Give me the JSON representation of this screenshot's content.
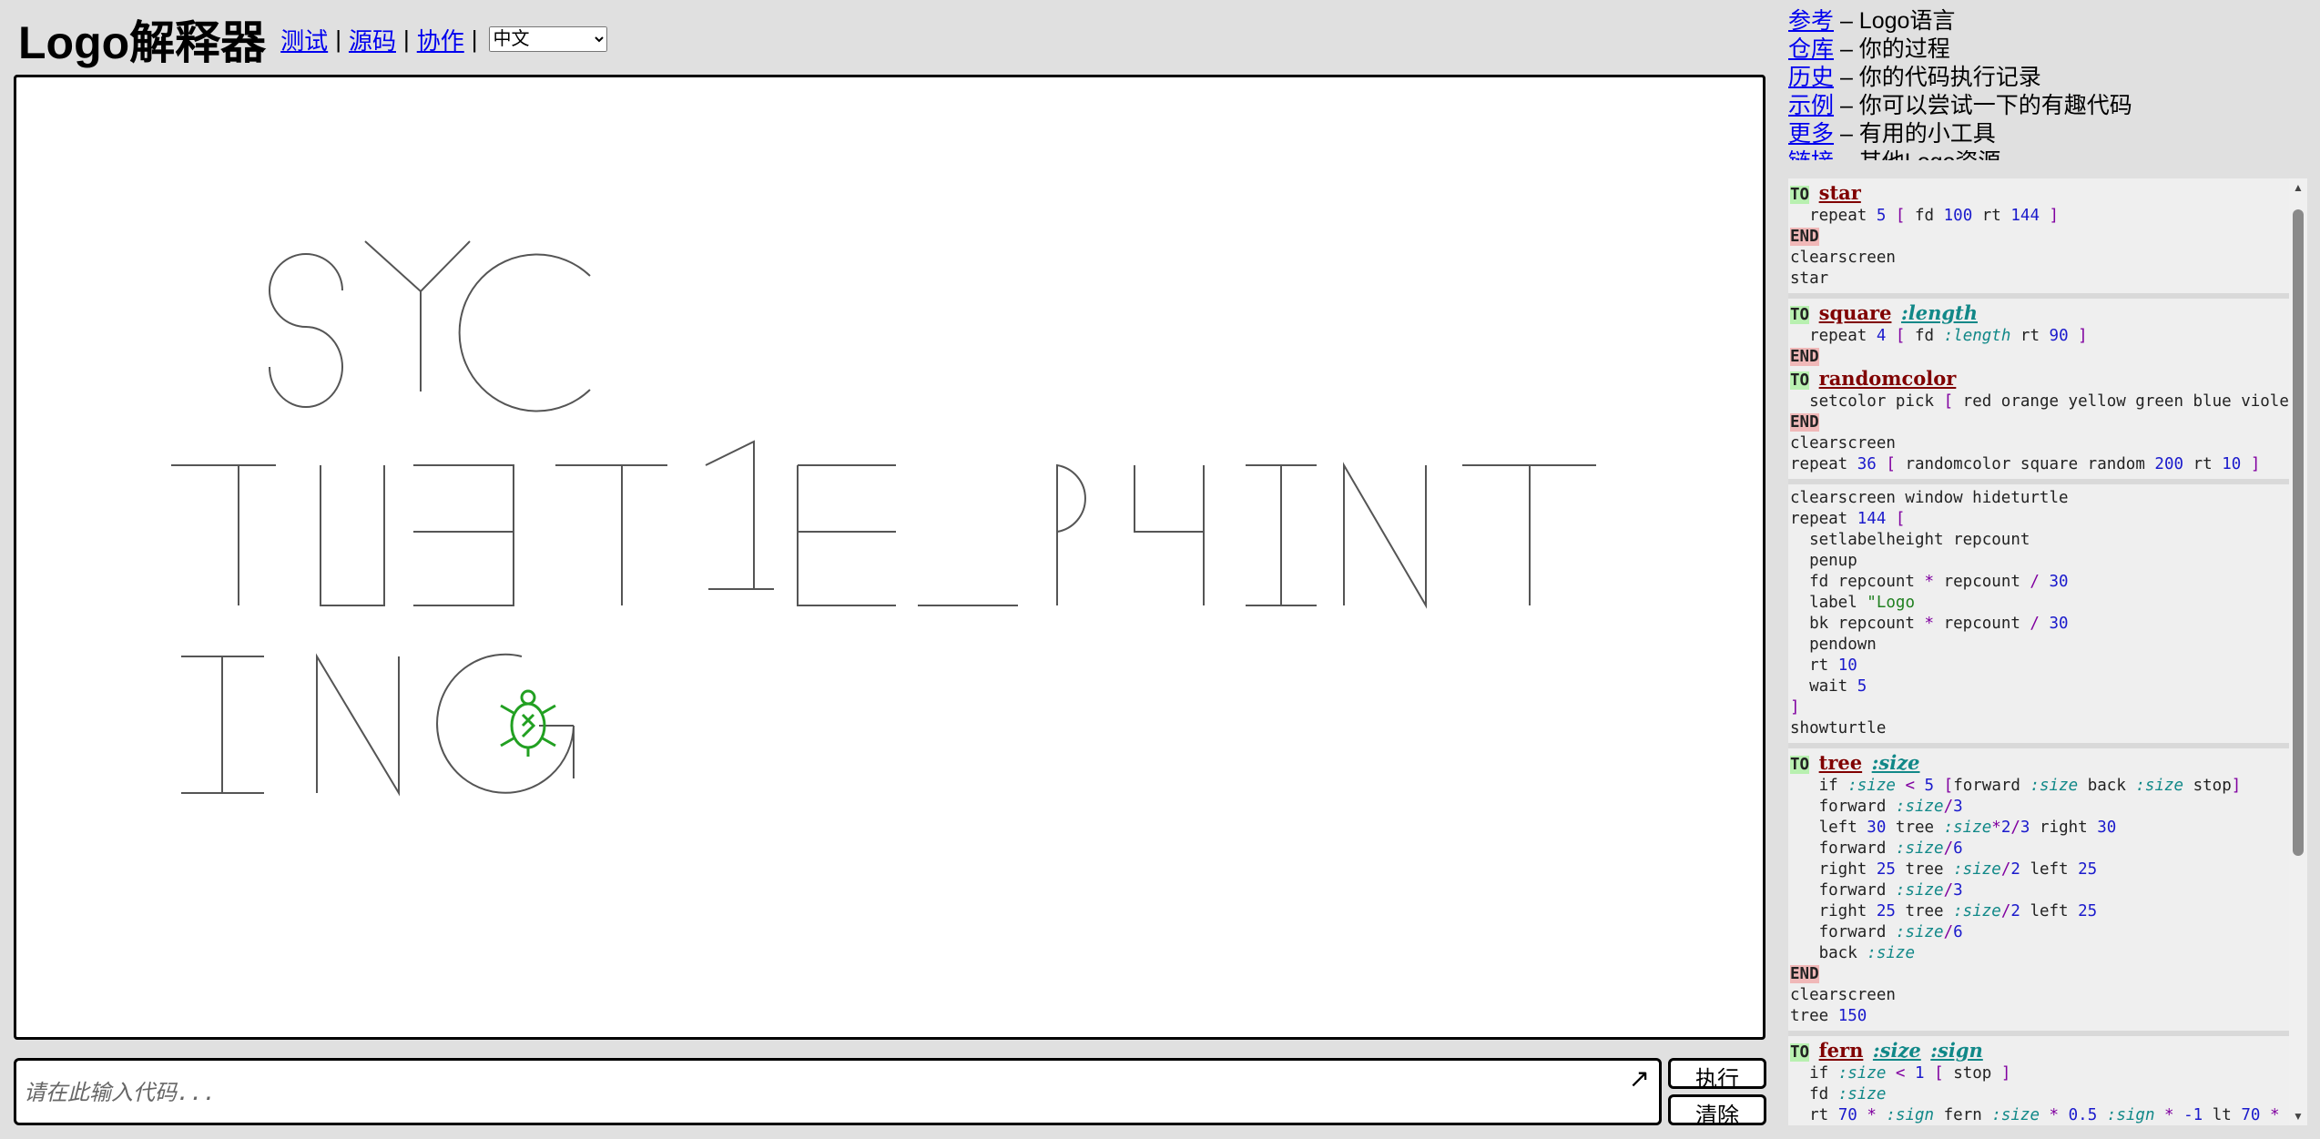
{
  "header": {
    "title": "Logo解释器",
    "nav": [
      {
        "label": "测试"
      },
      {
        "label": "源码"
      },
      {
        "label": "协作"
      }
    ],
    "separator": "|",
    "language": "中文"
  },
  "canvas": {
    "turtle_color": "#22a022",
    "line_color": "#555555"
  },
  "input": {
    "placeholder": "请在此输入代码...",
    "expand_icon": "↗",
    "run_label": "执行",
    "clear_label": "清除"
  },
  "links": [
    {
      "link": "参考",
      "desc": " – Logo语言"
    },
    {
      "link": "仓库",
      "desc": " – 你的过程"
    },
    {
      "link": "历史",
      "desc": " – 你的代码执行记录"
    },
    {
      "link": "示例",
      "desc": " – 你可以尝试一下的有趣代码"
    },
    {
      "link": "更多",
      "desc": " – 有用的小工具"
    },
    {
      "link": "链接",
      "desc": " – 其他Logo资源"
    }
  ],
  "examples": [
    [
      [
        {
          "t": "TO",
          "c": "kw-to"
        },
        {
          "t": " "
        },
        {
          "t": "star",
          "c": "proc"
        }
      ],
      [
        {
          "t": "  repeat "
        },
        {
          "t": "5",
          "c": "num"
        },
        {
          "t": " "
        },
        {
          "t": "[",
          "c": "br"
        },
        {
          "t": " fd "
        },
        {
          "t": "100",
          "c": "num"
        },
        {
          "t": " rt "
        },
        {
          "t": "144",
          "c": "num"
        },
        {
          "t": " "
        },
        {
          "t": "]",
          "c": "br"
        }
      ],
      [
        {
          "t": "END",
          "c": "kw-end"
        }
      ],
      [
        {
          "t": "clearscreen"
        }
      ],
      [
        {
          "t": "star"
        }
      ]
    ],
    [
      [
        {
          "t": "TO",
          "c": "kw-to"
        },
        {
          "t": " "
        },
        {
          "t": "square",
          "c": "proc"
        },
        {
          "t": " "
        },
        {
          "t": ":length",
          "c": "var proc-var"
        }
      ],
      [
        {
          "t": "  repeat "
        },
        {
          "t": "4",
          "c": "num"
        },
        {
          "t": " "
        },
        {
          "t": "[",
          "c": "br"
        },
        {
          "t": " fd "
        },
        {
          "t": ":length",
          "c": "var"
        },
        {
          "t": " rt "
        },
        {
          "t": "90",
          "c": "num"
        },
        {
          "t": " "
        },
        {
          "t": "]",
          "c": "br"
        }
      ],
      [
        {
          "t": "END",
          "c": "kw-end"
        }
      ],
      [
        {
          "t": "TO",
          "c": "kw-to"
        },
        {
          "t": " "
        },
        {
          "t": "randomcolor",
          "c": "proc"
        }
      ],
      [
        {
          "t": "  setcolor pick "
        },
        {
          "t": "[",
          "c": "br"
        },
        {
          "t": " red orange yellow green blue violet "
        },
        {
          "t": "]",
          "c": "br"
        }
      ],
      [
        {
          "t": "END",
          "c": "kw-end"
        }
      ],
      [
        {
          "t": "clearscreen"
        }
      ],
      [
        {
          "t": "repeat "
        },
        {
          "t": "36",
          "c": "num"
        },
        {
          "t": " "
        },
        {
          "t": "[",
          "c": "br"
        },
        {
          "t": " randomcolor square random "
        },
        {
          "t": "200",
          "c": "num"
        },
        {
          "t": " rt "
        },
        {
          "t": "10",
          "c": "num"
        },
        {
          "t": " "
        },
        {
          "t": "]",
          "c": "br"
        }
      ]
    ],
    [
      [
        {
          "t": "clearscreen window hideturtle"
        }
      ],
      [
        {
          "t": "repeat "
        },
        {
          "t": "144",
          "c": "num"
        },
        {
          "t": " "
        },
        {
          "t": "[",
          "c": "br"
        }
      ],
      [
        {
          "t": "  setlabelheight repcount"
        }
      ],
      [
        {
          "t": "  penup"
        }
      ],
      [
        {
          "t": "  fd repcount "
        },
        {
          "t": "*",
          "c": "br"
        },
        {
          "t": " repcount "
        },
        {
          "t": "/",
          "c": "br"
        },
        {
          "t": " "
        },
        {
          "t": "30",
          "c": "num"
        }
      ],
      [
        {
          "t": "  label "
        },
        {
          "t": "\"Logo",
          "c": "str"
        }
      ],
      [
        {
          "t": "  bk repcount "
        },
        {
          "t": "*",
          "c": "br"
        },
        {
          "t": " repcount "
        },
        {
          "t": "/",
          "c": "br"
        },
        {
          "t": " "
        },
        {
          "t": "30",
          "c": "num"
        }
      ],
      [
        {
          "t": "  pendown"
        }
      ],
      [
        {
          "t": "  rt "
        },
        {
          "t": "10",
          "c": "num"
        }
      ],
      [
        {
          "t": "  wait "
        },
        {
          "t": "5",
          "c": "num"
        }
      ],
      [
        {
          "t": "]",
          "c": "br"
        }
      ],
      [
        {
          "t": "showturtle"
        }
      ]
    ],
    [
      [
        {
          "t": "TO",
          "c": "kw-to"
        },
        {
          "t": " "
        },
        {
          "t": "tree",
          "c": "proc"
        },
        {
          "t": " "
        },
        {
          "t": ":size",
          "c": "var proc-var"
        }
      ],
      [
        {
          "t": "   if "
        },
        {
          "t": ":size",
          "c": "var"
        },
        {
          "t": " "
        },
        {
          "t": "<",
          "c": "br"
        },
        {
          "t": " "
        },
        {
          "t": "5",
          "c": "num"
        },
        {
          "t": " "
        },
        {
          "t": "[",
          "c": "br"
        },
        {
          "t": "forward "
        },
        {
          "t": ":size",
          "c": "var"
        },
        {
          "t": " back "
        },
        {
          "t": ":size",
          "c": "var"
        },
        {
          "t": " stop"
        },
        {
          "t": "]",
          "c": "br"
        }
      ],
      [
        {
          "t": "   forward "
        },
        {
          "t": ":size",
          "c": "var"
        },
        {
          "t": "/",
          "c": "br"
        },
        {
          "t": "3",
          "c": "num"
        }
      ],
      [
        {
          "t": "   left "
        },
        {
          "t": "30",
          "c": "num"
        },
        {
          "t": " tree "
        },
        {
          "t": ":size",
          "c": "var"
        },
        {
          "t": "*",
          "c": "br"
        },
        {
          "t": "2",
          "c": "num"
        },
        {
          "t": "/",
          "c": "br"
        },
        {
          "t": "3",
          "c": "num"
        },
        {
          "t": " right "
        },
        {
          "t": "30",
          "c": "num"
        }
      ],
      [
        {
          "t": "   forward "
        },
        {
          "t": ":size",
          "c": "var"
        },
        {
          "t": "/",
          "c": "br"
        },
        {
          "t": "6",
          "c": "num"
        }
      ],
      [
        {
          "t": "   right "
        },
        {
          "t": "25",
          "c": "num"
        },
        {
          "t": " tree "
        },
        {
          "t": ":size",
          "c": "var"
        },
        {
          "t": "/",
          "c": "br"
        },
        {
          "t": "2",
          "c": "num"
        },
        {
          "t": " left "
        },
        {
          "t": "25",
          "c": "num"
        }
      ],
      [
        {
          "t": "   forward "
        },
        {
          "t": ":size",
          "c": "var"
        },
        {
          "t": "/",
          "c": "br"
        },
        {
          "t": "3",
          "c": "num"
        }
      ],
      [
        {
          "t": "   right "
        },
        {
          "t": "25",
          "c": "num"
        },
        {
          "t": " tree "
        },
        {
          "t": ":size",
          "c": "var"
        },
        {
          "t": "/",
          "c": "br"
        },
        {
          "t": "2",
          "c": "num"
        },
        {
          "t": " left "
        },
        {
          "t": "25",
          "c": "num"
        }
      ],
      [
        {
          "t": "   forward "
        },
        {
          "t": ":size",
          "c": "var"
        },
        {
          "t": "/",
          "c": "br"
        },
        {
          "t": "6",
          "c": "num"
        }
      ],
      [
        {
          "t": "   back "
        },
        {
          "t": ":size",
          "c": "var"
        }
      ],
      [
        {
          "t": "END",
          "c": "kw-end"
        }
      ],
      [
        {
          "t": "clearscreen"
        }
      ],
      [
        {
          "t": "tree "
        },
        {
          "t": "150",
          "c": "num"
        }
      ]
    ],
    [
      [
        {
          "t": "TO",
          "c": "kw-to"
        },
        {
          "t": " "
        },
        {
          "t": "fern",
          "c": "proc"
        },
        {
          "t": " "
        },
        {
          "t": ":size",
          "c": "var proc-var"
        },
        {
          "t": " "
        },
        {
          "t": ":sign",
          "c": "var proc-var"
        }
      ],
      [
        {
          "t": "  if "
        },
        {
          "t": ":size",
          "c": "var"
        },
        {
          "t": " "
        },
        {
          "t": "<",
          "c": "br"
        },
        {
          "t": " "
        },
        {
          "t": "1",
          "c": "num"
        },
        {
          "t": " "
        },
        {
          "t": "[",
          "c": "br"
        },
        {
          "t": " stop "
        },
        {
          "t": "]",
          "c": "br"
        }
      ],
      [
        {
          "t": "  fd "
        },
        {
          "t": ":size",
          "c": "var"
        }
      ],
      [
        {
          "t": "  rt "
        },
        {
          "t": "70",
          "c": "num"
        },
        {
          "t": " "
        },
        {
          "t": "*",
          "c": "br"
        },
        {
          "t": " "
        },
        {
          "t": ":sign",
          "c": "var"
        },
        {
          "t": " fern "
        },
        {
          "t": ":size",
          "c": "var"
        },
        {
          "t": " "
        },
        {
          "t": "*",
          "c": "br"
        },
        {
          "t": " "
        },
        {
          "t": "0.5",
          "c": "num"
        },
        {
          "t": " "
        },
        {
          "t": ":sign",
          "c": "var"
        },
        {
          "t": " "
        },
        {
          "t": "*",
          "c": "br"
        },
        {
          "t": " "
        },
        {
          "t": "-1",
          "c": "num"
        },
        {
          "t": " lt "
        },
        {
          "t": "70",
          "c": "num"
        },
        {
          "t": " "
        },
        {
          "t": "*",
          "c": "br"
        }
      ]
    ]
  ]
}
